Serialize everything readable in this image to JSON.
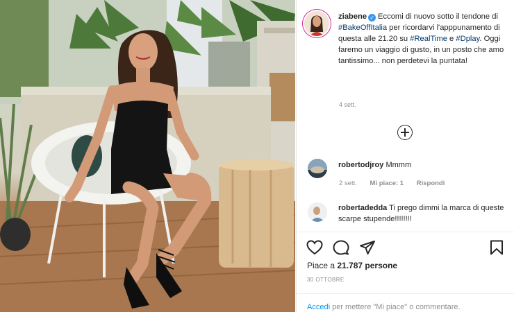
{
  "post": {
    "username": "ziabene",
    "caption_parts": [
      {
        "text": "Eccomi di nuovo sotto il tendone di ",
        "type": "text"
      },
      {
        "text": "#BakeOffItalia",
        "type": "tag"
      },
      {
        "text": " per ricordarvi l'apppunamento di questa alle 21.20 su ",
        "type": "text"
      },
      {
        "text": "#RealTime",
        "type": "tag"
      },
      {
        "text": " e ",
        "type": "text"
      },
      {
        "text": "#Dplay",
        "type": "tag"
      },
      {
        "text": ". Oggi faremo un viaggio di gusto, in un posto che amo tantissimo... non perdetevi la puntata!",
        "type": "text"
      }
    ],
    "age": "4 sett.",
    "verified_icon": "verified-badge-icon"
  },
  "comments": [
    {
      "username": "robertodjroy",
      "text": "Mmmm",
      "age": "2 sett.",
      "likes": "Mi piace: 1",
      "reply": "Rispondi"
    },
    {
      "username": "robertadedda",
      "text": "Ti prego dimmi la marca di queste scarpe stupende!!!!!!!!"
    }
  ],
  "actions": {
    "like_icon": "heart-icon",
    "comment_icon": "comment-icon",
    "share_icon": "share-icon",
    "save_icon": "bookmark-icon"
  },
  "likes": {
    "prefix": "Piace a ",
    "count": "21.787 persone"
  },
  "date": "30 OTTOBRE",
  "login": {
    "link": "Accedi",
    "rest": " per mettere \"Mi piace\" o commentare."
  },
  "colors": {
    "link": "#00376b",
    "accent": "#0095f6",
    "muted": "#8e8e8e",
    "verified": "#3897f0"
  }
}
